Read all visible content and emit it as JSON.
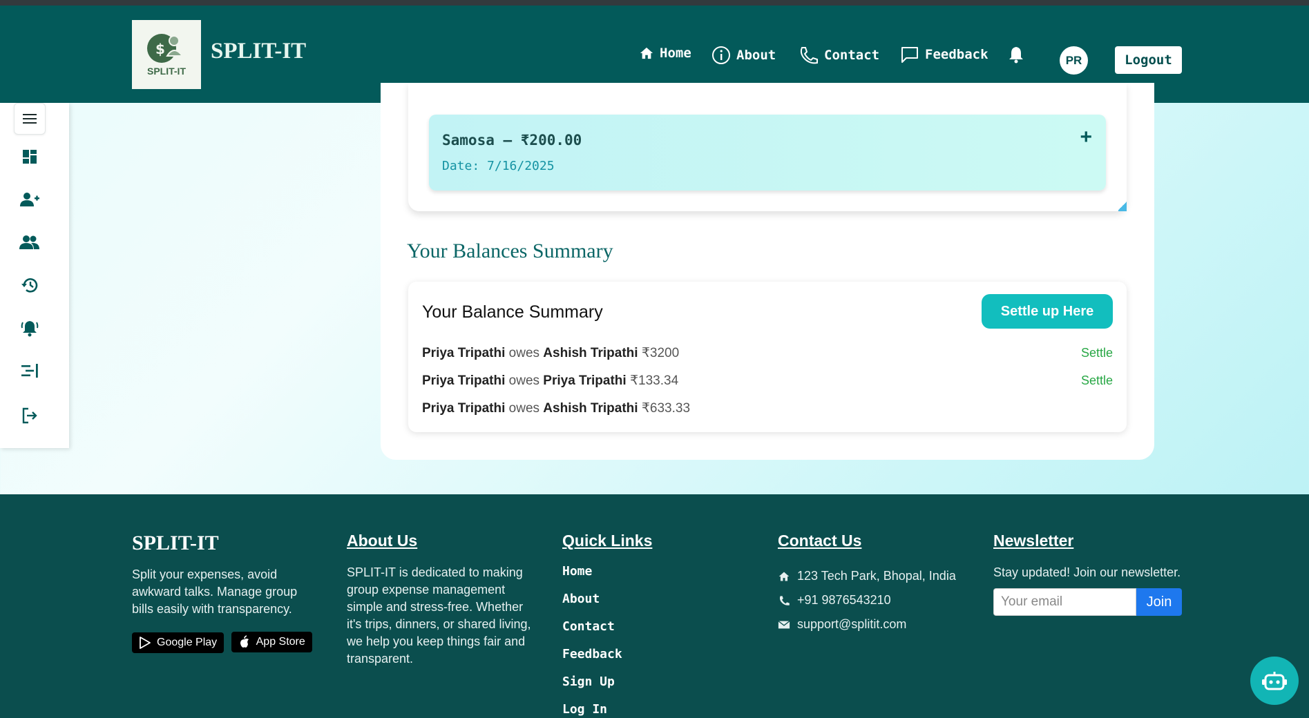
{
  "app": {
    "logo_text": "SPLIT-IT",
    "brand": "SPLIT-IT"
  },
  "nav": {
    "home": "Home",
    "about": "About",
    "contact": "Contact",
    "feedback": "Feedback",
    "avatar_initials": "PR",
    "logout": "Logout"
  },
  "sidebar": {
    "items": [
      "menu-icon",
      "dashboard-icon",
      "add-user-icon",
      "group-icon",
      "history-icon",
      "notification-icon",
      "collapse-icon",
      "logout-icon"
    ]
  },
  "expense": {
    "title": "Samosa — ₹200.00",
    "date": "Date: 7/16/2025",
    "expand": "+"
  },
  "balances": {
    "section_title": "Your Balances Summary",
    "card_title": "Your Balance Summary",
    "settle_up_label": "Settle up Here",
    "owes_word": "owes",
    "settle_label": "Settle",
    "rows": [
      {
        "from": "Priya Tripathi",
        "to": "Ashish Tripathi",
        "amount": "₹3200"
      },
      {
        "from": "Priya Tripathi",
        "to": "Priya Tripathi",
        "amount": "₹133.34"
      },
      {
        "from": "Priya Tripathi",
        "to": "Ashish Tripathi",
        "amount": "₹633.33"
      }
    ]
  },
  "footer": {
    "brand": "SPLIT-IT",
    "tagline": "Split your expenses, avoid awkward talks. Manage group bills easily with transparency.",
    "google_play": "Google Play",
    "app_store": "App Store",
    "about_head": "About Us",
    "about_text": "SPLIT-IT is dedicated to making group expense management simple and stress-free. Whether it's trips, dinners, or shared living, we help you keep things fair and transparent.",
    "quick_head": "Quick Links",
    "quick_links": [
      "Home",
      "About",
      "Contact",
      "Feedback",
      "Sign Up",
      "Log In"
    ],
    "contact_head": "Contact Us",
    "address": "123 Tech Park, Bhopal, India",
    "phone": "+91 9876543210",
    "email": "support@splitit.com",
    "newsletter_head": "Newsletter",
    "newsletter_text": "Stay updated! Join our newsletter.",
    "email_placeholder": "Your email",
    "join": "Join"
  },
  "colors": {
    "header_bg": "#035a5a",
    "footer_bg": "#0b4e4e",
    "accent": "#12bebe",
    "settle": "#28a745"
  }
}
